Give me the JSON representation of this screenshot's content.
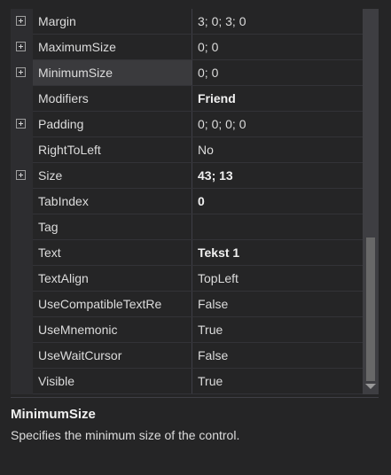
{
  "properties": [
    {
      "name": "Margin",
      "value": "3; 0; 3; 0",
      "expandable": true,
      "bold": false
    },
    {
      "name": "MaximumSize",
      "value": "0; 0",
      "expandable": true,
      "bold": false
    },
    {
      "name": "MinimumSize",
      "value": "0; 0",
      "expandable": true,
      "bold": false,
      "selected": true
    },
    {
      "name": "Modifiers",
      "value": "Friend",
      "expandable": false,
      "bold": true
    },
    {
      "name": "Padding",
      "value": "0; 0; 0; 0",
      "expandable": true,
      "bold": false
    },
    {
      "name": "RightToLeft",
      "value": "No",
      "expandable": false,
      "bold": false
    },
    {
      "name": "Size",
      "value": "43; 13",
      "expandable": true,
      "bold": true
    },
    {
      "name": "TabIndex",
      "value": "0",
      "expandable": false,
      "bold": true
    },
    {
      "name": "Tag",
      "value": "",
      "expandable": false,
      "bold": false
    },
    {
      "name": "Text",
      "value": "Tekst 1",
      "expandable": false,
      "bold": true
    },
    {
      "name": "TextAlign",
      "value": "TopLeft",
      "expandable": false,
      "bold": false
    },
    {
      "name": "UseCompatibleTextRe",
      "value": "False",
      "expandable": false,
      "bold": false
    },
    {
      "name": "UseMnemonic",
      "value": "True",
      "expandable": false,
      "bold": false
    },
    {
      "name": "UseWaitCursor",
      "value": "False",
      "expandable": false,
      "bold": false
    },
    {
      "name": "Visible",
      "value": "True",
      "expandable": false,
      "bold": false
    }
  ],
  "help": {
    "title": "MinimumSize",
    "description": "Specifies the minimum size of the control."
  },
  "icons": {
    "expander": "plus-box-icon",
    "scroll_down": "triangle-down-icon"
  },
  "colors": {
    "background": "#252526",
    "gutter": "#2d2d30",
    "text": "#dcdcdc",
    "bold_text": "#f1f1f1",
    "scrollbar_track": "#3e3e42",
    "scrollbar_thumb": "#686868"
  }
}
